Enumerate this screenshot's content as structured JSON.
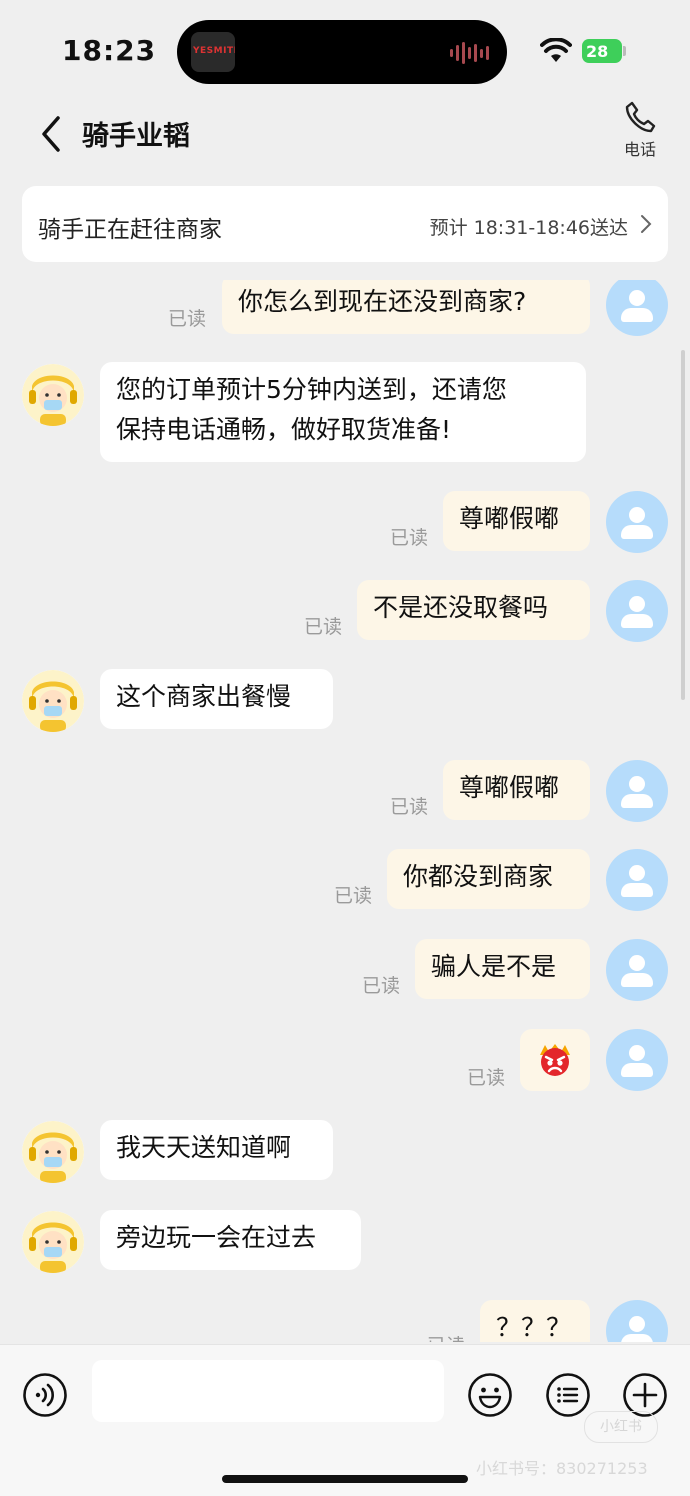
{
  "status_bar": {
    "time": "18:23",
    "battery": "28",
    "island_art_text": "YESMITE"
  },
  "header": {
    "title": "骑手业韬",
    "phone_label": "电话"
  },
  "delivery_card": {
    "status": "骑手正在赶往商家",
    "eta": "预计 18:31-18:46送达"
  },
  "read_label": "已读",
  "messages": [
    {
      "side": "out",
      "text": "你怎么到现在还没到商家?"
    },
    {
      "side": "in",
      "text": "您的订单预计5分钟内送到，还请您保持电话通畅，做好取货准备!",
      "line1": "您的订单预计5分钟内送到，还请您",
      "line2": "保持电话通畅，做好取货准备!"
    },
    {
      "side": "out",
      "text": "尊嘟假嘟"
    },
    {
      "side": "out",
      "text": "不是还没取餐吗"
    },
    {
      "side": "in",
      "text": "这个商家出餐慢"
    },
    {
      "side": "out",
      "text": "尊嘟假嘟"
    },
    {
      "side": "out",
      "text": "你都没到商家"
    },
    {
      "side": "out",
      "text": "骗人是不是"
    },
    {
      "side": "out",
      "emoji": "angry-face"
    },
    {
      "side": "in",
      "text": "我天天送知道啊"
    },
    {
      "side": "in",
      "text": "旁边玩一会在过去"
    },
    {
      "side": "out",
      "text": "？？？"
    }
  ],
  "watermark": {
    "logo": "小红书",
    "text": "小红书号：830271253"
  }
}
